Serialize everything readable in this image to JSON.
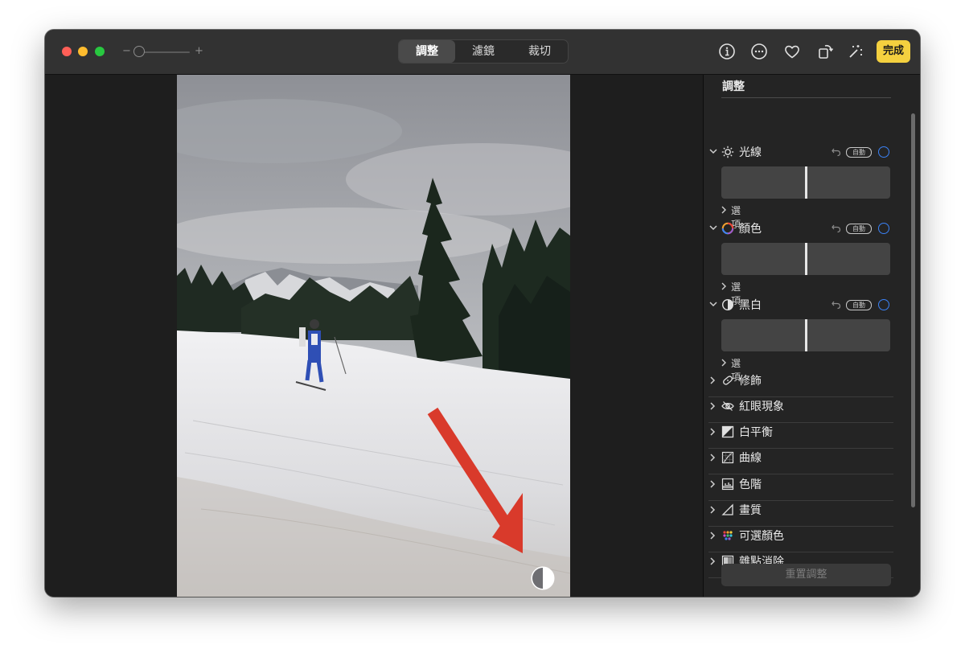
{
  "toolbar": {
    "zoom_minus": "−",
    "zoom_plus": "+",
    "tabs": [
      {
        "label": "調整",
        "active": true
      },
      {
        "label": "濾鏡",
        "active": false
      },
      {
        "label": "裁切",
        "active": false
      }
    ],
    "icons": [
      "info-icon",
      "more-icon",
      "heart-icon",
      "rotate-icon",
      "auto-enhance-icon"
    ],
    "done_label": "完成",
    "done_color": "#f4d03f"
  },
  "sidebar": {
    "title": "調整",
    "sections": [
      {
        "label": "光線",
        "icon": "sun-icon",
        "auto": "自動",
        "options": "選項"
      },
      {
        "label": "顏色",
        "icon": "color-wheel-icon",
        "auto": "自動",
        "options": "選項"
      },
      {
        "label": "黑白",
        "icon": "half-circle-icon",
        "auto": "自動",
        "options": "選項"
      }
    ],
    "tools": [
      {
        "label": "修飾",
        "icon": "bandage-icon"
      },
      {
        "label": "紅眼現象",
        "icon": "eye-icon"
      },
      {
        "label": "白平衡",
        "icon": "white-balance-icon"
      },
      {
        "label": "曲線",
        "icon": "curves-icon"
      },
      {
        "label": "色階",
        "icon": "levels-icon"
      },
      {
        "label": "畫質",
        "icon": "definition-icon"
      },
      {
        "label": "可選顏色",
        "icon": "selective-color-icon"
      },
      {
        "label": "雜點消除",
        "icon": "noise-reduction-icon"
      }
    ],
    "reset_label": "重置調整"
  },
  "colors": {
    "accent_blue": "#3b82f6",
    "annotation_arrow": "#d93a2b"
  }
}
